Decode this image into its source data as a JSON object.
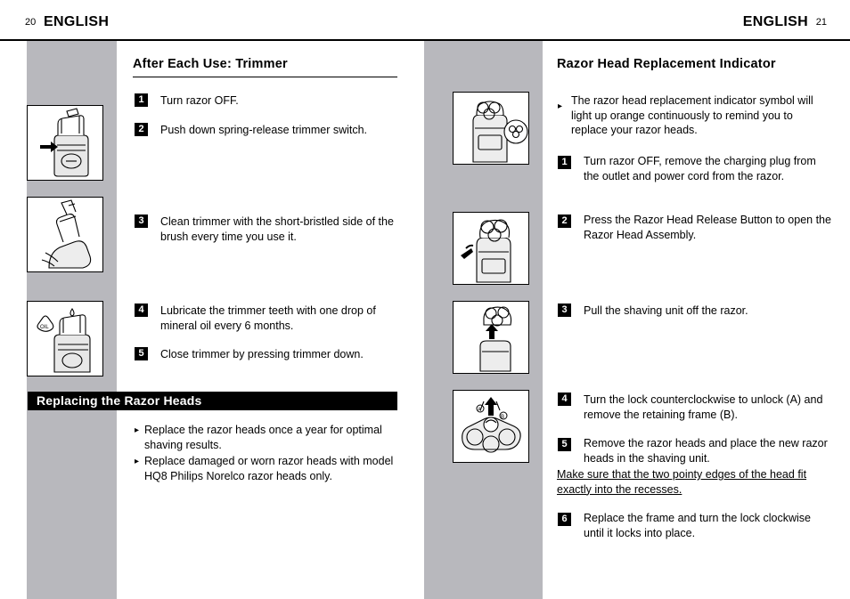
{
  "header": {
    "left_page_number": "20",
    "left_title": "ENGLISH",
    "right_title": "ENGLISH",
    "right_page_number": "21"
  },
  "left_column": {
    "section_title": "After Each Use: Trimmer",
    "steps": [
      {
        "num": "1",
        "text": "Turn razor OFF."
      },
      {
        "num": "2",
        "text": "Push down spring-release trimmer switch."
      },
      {
        "num": "3",
        "text": "Clean trimmer with the short-bristled side of the brush every time you use it."
      },
      {
        "num": "4",
        "text": "Lubricate the trimmer teeth with one drop of mineral oil every 6 months."
      },
      {
        "num": "5",
        "text": "Close trimmer by pressing trimmer down."
      }
    ],
    "banner_title": "Replacing the Razor Heads",
    "bullets": [
      "Replace the razor heads once a year for optimal shaving results.",
      "Replace damaged or worn razor heads with model HQ8 Philips Norelco razor heads only."
    ],
    "figures": [
      {
        "name": "trimmer-switch-figure"
      },
      {
        "name": "trimmer-brush-cleaning-figure"
      },
      {
        "name": "trimmer-oil-figure"
      }
    ]
  },
  "right_column": {
    "section_title": "Razor Head Replacement Indicator",
    "intro_bullet": "The razor head replacement indicator symbol will light up orange continuously to remind you to replace your razor heads.",
    "steps": [
      {
        "num": "1",
        "text": "Turn razor OFF, remove the charging plug from the outlet and power cord from the razor."
      },
      {
        "num": "2",
        "text": "Press the Razor Head Release Button to open the Razor Head Assembly."
      },
      {
        "num": "3",
        "text": "Pull the shaving unit off the razor."
      },
      {
        "num": "4",
        "text": "Turn the lock counterclockwise to unlock (A) and remove the retaining frame (B)."
      },
      {
        "num": "5",
        "text": "Remove the razor heads and place the new razor heads in the shaving unit."
      },
      {
        "num": "6",
        "text": "Replace the frame and turn the lock clockwise until it locks into place."
      }
    ],
    "note": "Make sure that the two pointy edges of the head fit exactly into the recesses.",
    "figures": [
      {
        "name": "razor-indicator-figure"
      },
      {
        "name": "razor-head-release-figure"
      },
      {
        "name": "shaving-unit-removal-figure"
      },
      {
        "name": "retaining-frame-figure"
      }
    ]
  },
  "colors": {
    "gray_panel": "#b8b8bd",
    "ink": "#000000",
    "paper": "#ffffff"
  }
}
